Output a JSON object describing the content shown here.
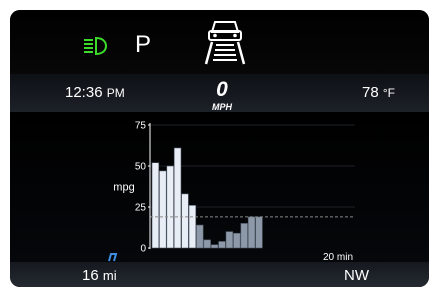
{
  "colors": {
    "screen_bg": "#000000",
    "headlight_indicator": "#3ddc2a",
    "bar_high": "#e9edf6",
    "bar_low": "#8d98a8",
    "accent_blue": "#3e8fe0",
    "reference_line": "#8a8a8a"
  },
  "status_bar": {
    "headlight_icon": "headlight-on-icon",
    "gear": "P",
    "lane_icon": "lane-assist-icon"
  },
  "info_bar": {
    "time": "12:36",
    "time_suffix": "PM",
    "speed": "0",
    "speed_unit": "MPH",
    "temperature": "78",
    "temperature_unit": "°F"
  },
  "chart_data": {
    "type": "bar",
    "title": "",
    "ylabel": "mpg",
    "xlabel": "",
    "ylim": [
      0,
      75
    ],
    "yticks": [
      "75",
      "50",
      "25",
      "0"
    ],
    "time_span_label": "20 min",
    "reference_value": 19,
    "values": [
      52,
      47,
      50,
      61,
      33,
      26,
      14,
      5,
      2,
      4,
      10,
      9,
      15,
      19,
      19
    ],
    "grid": true,
    "legend": "none"
  },
  "trip": {
    "distance": "16",
    "distance_unit": "mi",
    "compass": "NW"
  }
}
